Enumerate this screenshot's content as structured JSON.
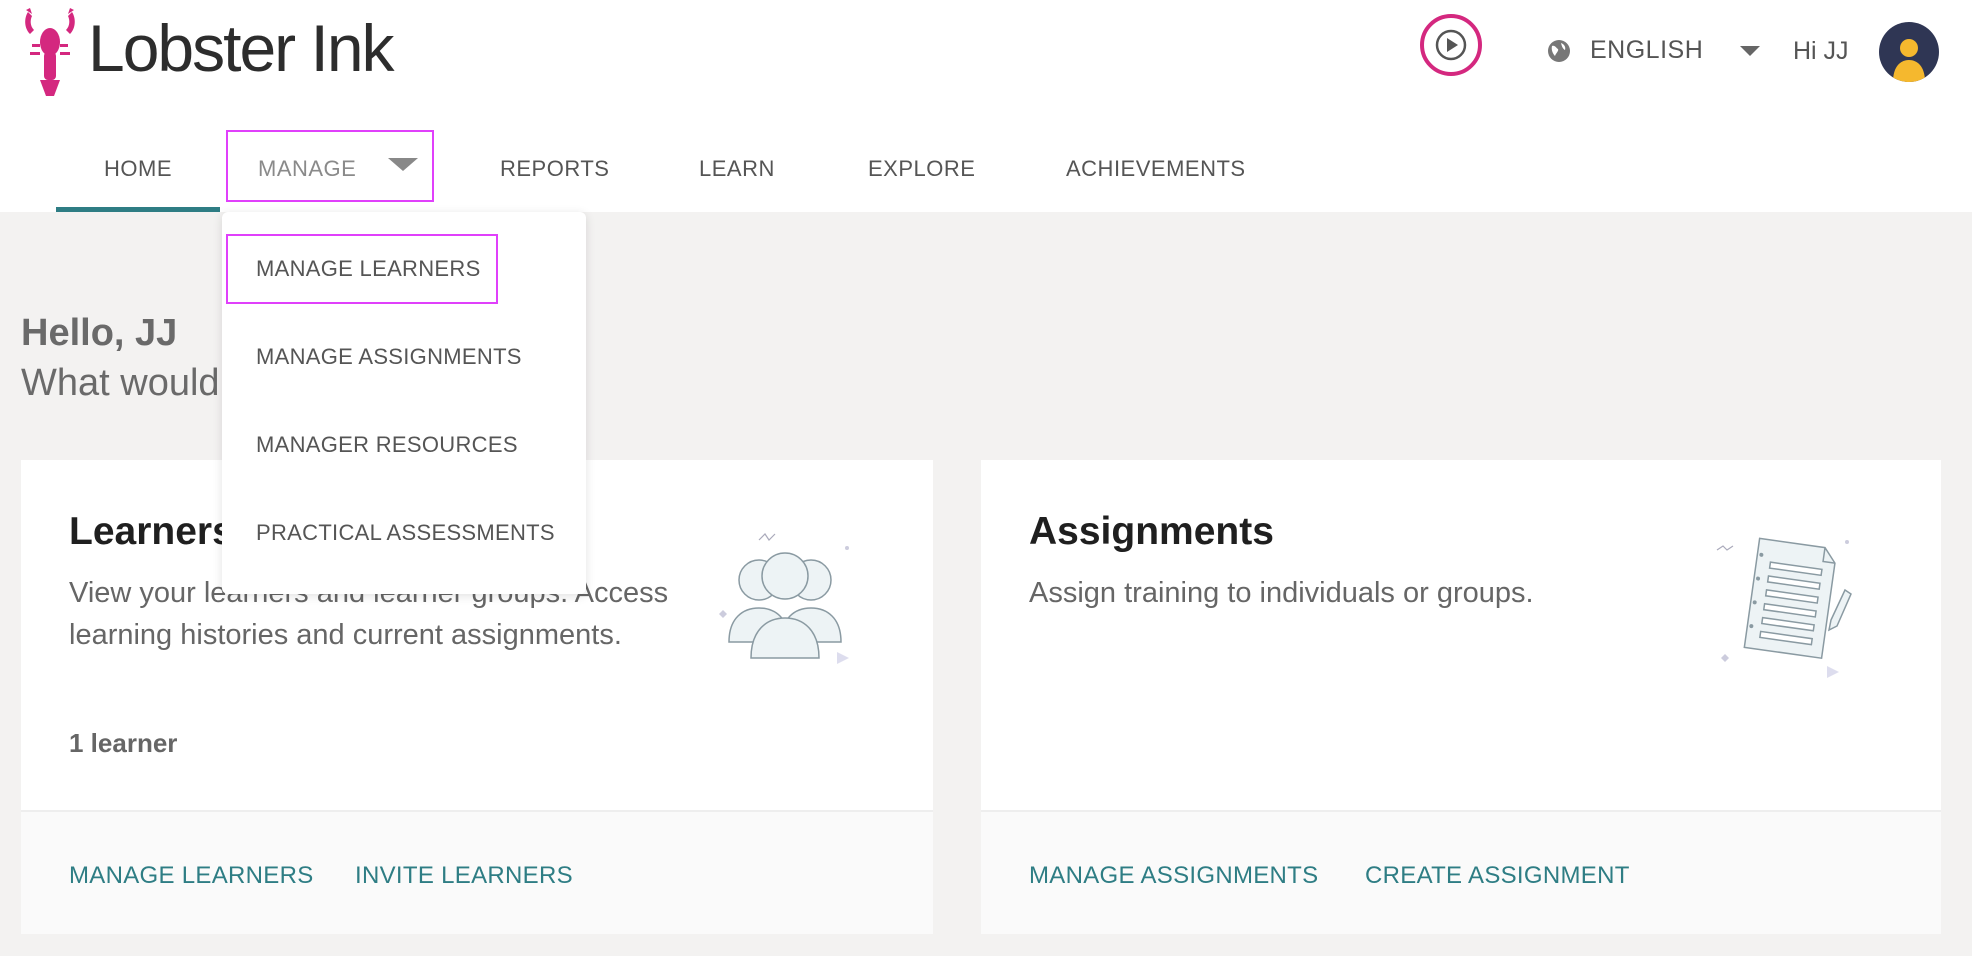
{
  "header": {
    "logo_text": "Lobster Ink",
    "language": "ENGLISH",
    "greeting": "Hi JJ"
  },
  "nav": {
    "items": [
      {
        "label": "HOME"
      },
      {
        "label": "MANAGE"
      },
      {
        "label": "REPORTS"
      },
      {
        "label": "LEARN"
      },
      {
        "label": "EXPLORE"
      },
      {
        "label": "ACHIEVEMENTS"
      }
    ]
  },
  "dropdown": {
    "items": [
      {
        "label": "MANAGE LEARNERS"
      },
      {
        "label": "MANAGE ASSIGNMENTS"
      },
      {
        "label": "MANAGER RESOURCES"
      },
      {
        "label": "PRACTICAL ASSESSMENTS"
      }
    ]
  },
  "welcome": {
    "hello": "Hello, JJ",
    "question": "What would you like to do today?"
  },
  "cards": {
    "learners": {
      "title": "Learners",
      "description": "View your learners and learner groups. Access learning histories and current assignments.",
      "count": "1 learner",
      "links": [
        "MANAGE LEARNERS",
        "INVITE LEARNERS"
      ]
    },
    "assignments": {
      "title": "Assignments",
      "description": "Assign training to individuals or groups.",
      "links": [
        "MANAGE ASSIGNMENTS",
        "CREATE ASSIGNMENT"
      ]
    }
  },
  "colors": {
    "brand_pink": "#d4287f",
    "accent_teal": "#2e7d84",
    "highlight_magenta": "#e040fb",
    "avatar_bg": "#2f3654"
  },
  "icons": {
    "logo": "lobster-logo-icon",
    "play": "play-circle-icon",
    "language": "globe-icon",
    "avatar": "user-avatar-icon",
    "learners_illustration": "people-group-illustration",
    "assignments_illustration": "document-pencil-illustration"
  }
}
